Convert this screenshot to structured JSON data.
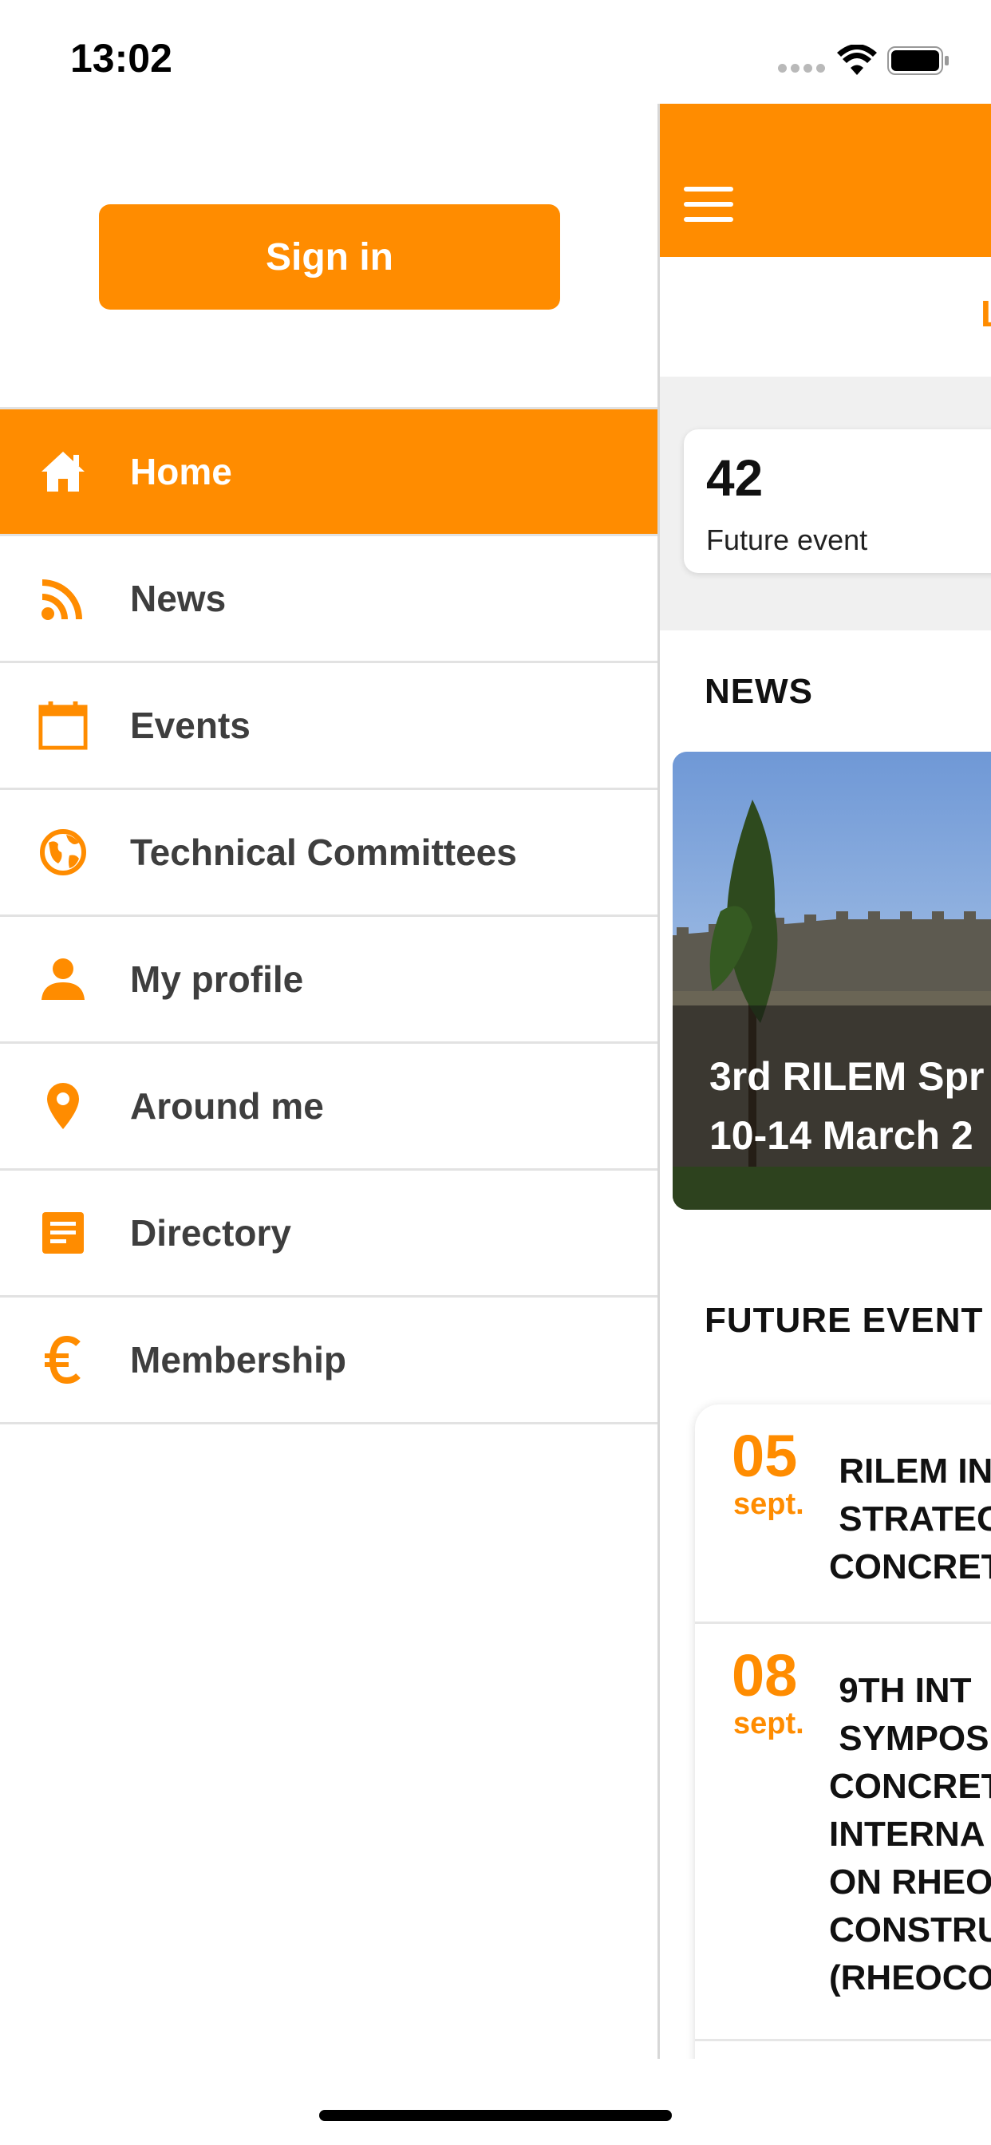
{
  "status_bar": {
    "time": "13:02"
  },
  "drawer": {
    "sign_in_label": "Sign in",
    "accent_color": "#ff8c00",
    "menu": [
      {
        "label": "Home",
        "icon": "home-icon",
        "active": true
      },
      {
        "label": "News",
        "icon": "rss-icon",
        "active": false
      },
      {
        "label": "Events",
        "icon": "calendar-icon",
        "active": false
      },
      {
        "label": "Technical Committees",
        "icon": "globe-icon",
        "active": false
      },
      {
        "label": "My profile",
        "icon": "person-icon",
        "active": false
      },
      {
        "label": "Around me",
        "icon": "location-pin-icon",
        "active": false
      },
      {
        "label": "Directory",
        "icon": "document-icon",
        "active": false
      },
      {
        "label": "Membership",
        "icon": "euro-icon",
        "active": false
      }
    ]
  },
  "main": {
    "tab_fragment": "L",
    "stat_card": {
      "number": "42",
      "label": "Future event"
    },
    "news_section_title": "NEWS",
    "news_card": {
      "line1": "3rd RILEM Spr",
      "line2": "10-14 March 2"
    },
    "future_events_title": "FUTURE EVENT",
    "events": [
      {
        "day": "05",
        "month": "sept.",
        "title": " RILEM IN\n STRATEG\nCONCRET"
      },
      {
        "day": "08",
        "month": "sept.",
        "title": " 9TH INT\n SYMPOS\nCONCRET\nINTERNA\nON RHEO\nCONSTRU\n(RHEOCO"
      }
    ]
  }
}
